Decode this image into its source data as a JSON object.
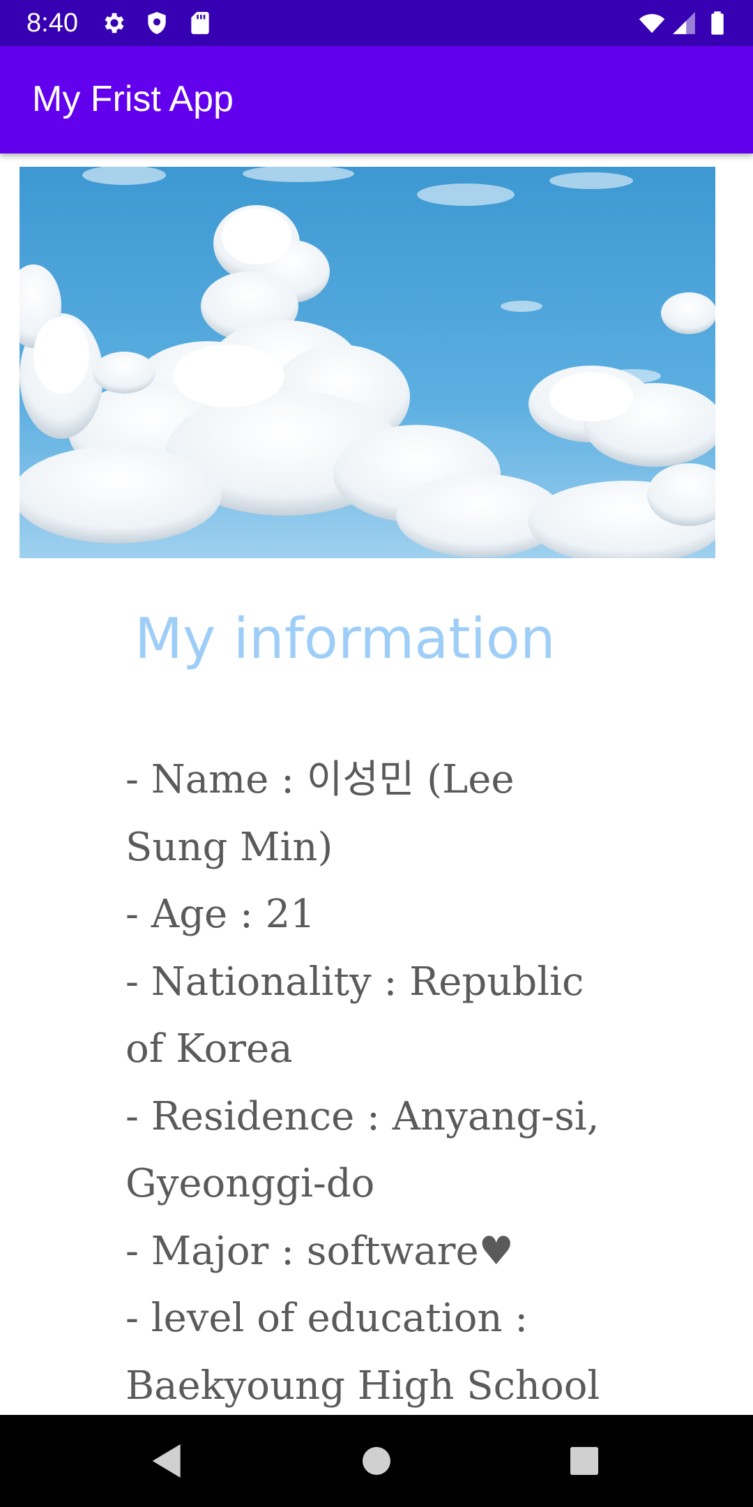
{
  "status_bar": {
    "time": "8:40",
    "icons": [
      "gear-icon",
      "shield-icon",
      "sd-card-icon",
      "wifi-icon",
      "signal-icon",
      "battery-icon"
    ]
  },
  "app_bar": {
    "title": "My Frist App",
    "color": "#6200ee"
  },
  "content": {
    "image": "sky-clouds-image",
    "heading": "My information",
    "heading_color": "#9ecef8",
    "lines": [
      "- Name : 이성민 (Lee",
      "Sung Min)",
      "- Age : 21",
      "- Nationality : Republic",
      "of Korea",
      "- Residence : Anyang-si,",
      "Gyeonggi-do",
      "- Major : software♥",
      "- level of education :",
      "Baekyoung High School"
    ]
  },
  "nav_bar": {
    "buttons": [
      "back-icon",
      "home-icon",
      "recents-icon"
    ]
  }
}
